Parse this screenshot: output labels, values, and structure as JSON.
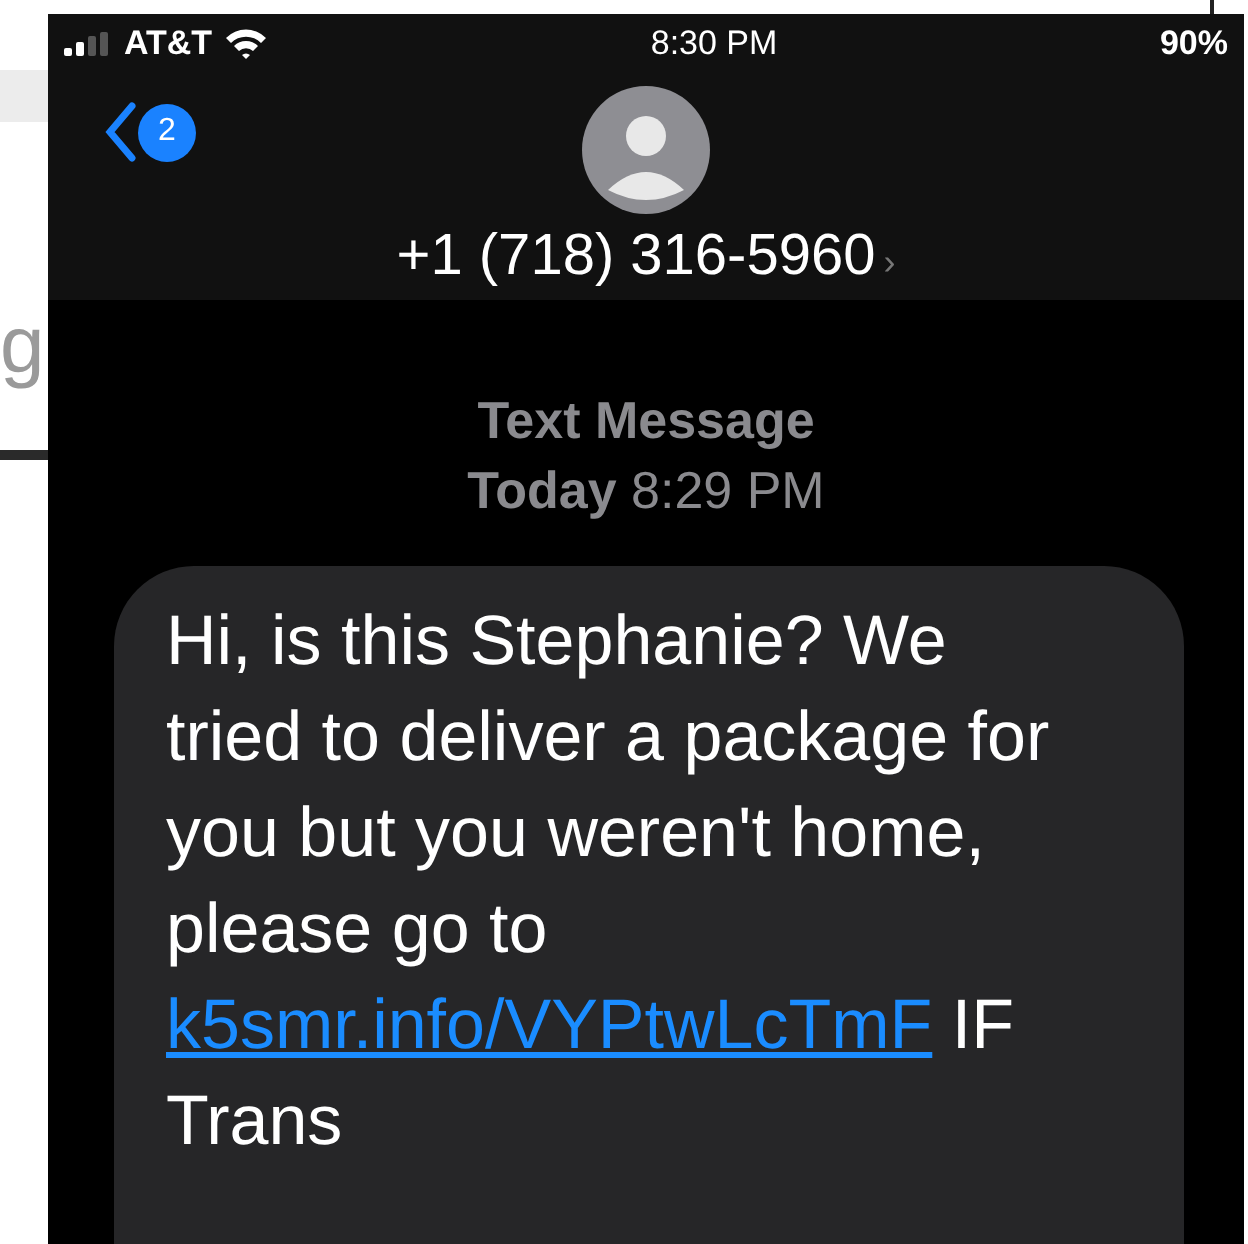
{
  "background_page": {
    "text_fragment": "g"
  },
  "status_bar": {
    "carrier": "AT&T",
    "time": "8:30 PM",
    "battery": "90%"
  },
  "nav": {
    "back_badge": "2",
    "contact": "+1 (718) 316-5960",
    "contact_chevron": "›"
  },
  "conversation": {
    "service": "Text Message",
    "day": "Today",
    "time": "8:29 PM"
  },
  "message": {
    "text_before": "Hi, is this Stephanie? We tried to deliver a package for you but you weren't home, please go to",
    "link": "k5smr.info/VYPtwLcTmF",
    "text_after": "IF Trans"
  }
}
